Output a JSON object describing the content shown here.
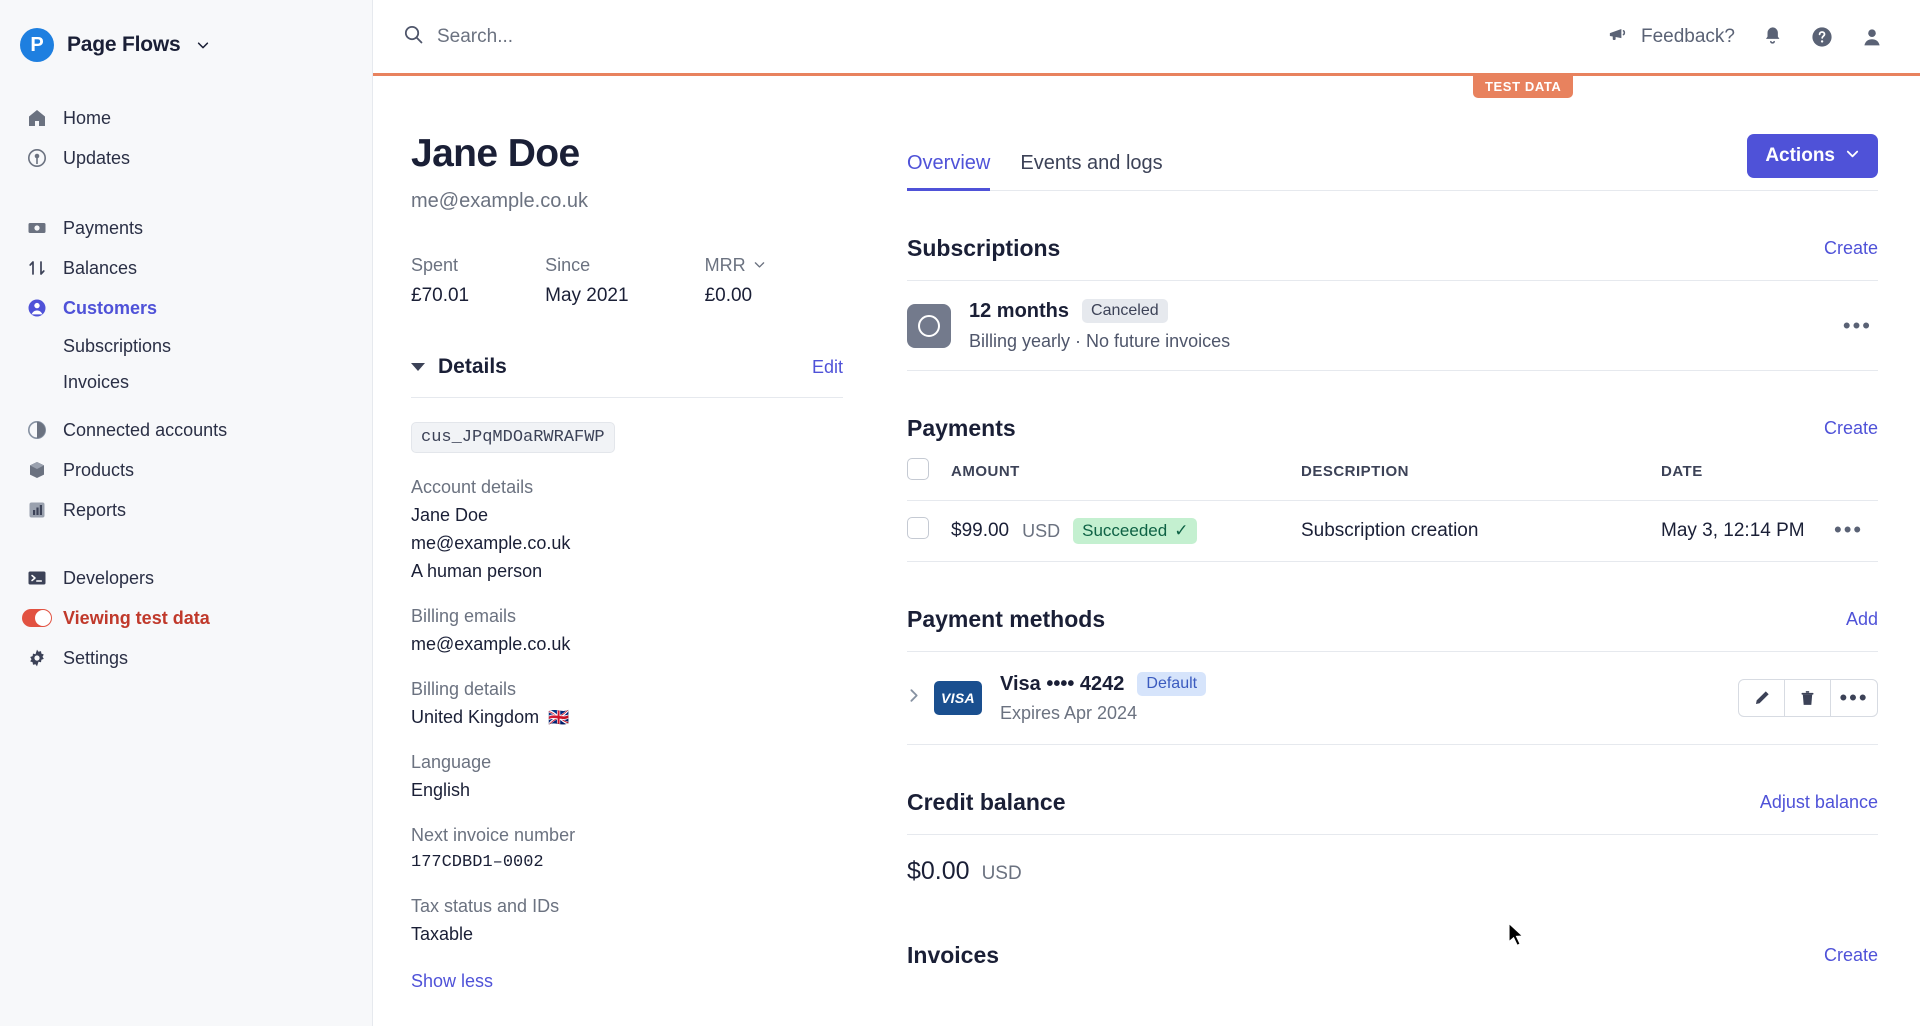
{
  "sidebar": {
    "brand": {
      "logo_letter": "P",
      "name": "Page Flows",
      "caret": "⌄"
    },
    "groups": [
      {
        "items": [
          {
            "label": "Home",
            "icon": "home-icon"
          },
          {
            "label": "Updates",
            "icon": "broadcast-icon"
          }
        ]
      },
      {
        "items": [
          {
            "label": "Payments",
            "icon": "payments-icon"
          },
          {
            "label": "Balances",
            "icon": "balances-icon"
          },
          {
            "label": "Customers",
            "icon": "customers-icon",
            "active": true
          },
          {
            "label": "Subscriptions",
            "sub": true
          },
          {
            "label": "Invoices",
            "sub": true
          },
          {
            "label": "Connected accounts",
            "icon": "connected-accounts-icon"
          },
          {
            "label": "Products",
            "icon": "products-icon"
          },
          {
            "label": "Reports",
            "icon": "reports-icon"
          }
        ]
      },
      {
        "items": [
          {
            "label": "Developers",
            "icon": "terminal-icon"
          },
          {
            "label": "Viewing test data",
            "icon": "toggle-on-icon",
            "testdata": true
          },
          {
            "label": "Settings",
            "icon": "gear-icon"
          }
        ]
      }
    ]
  },
  "topbar": {
    "search_placeholder": "Search...",
    "feedback_label": "Feedback?",
    "notifications_icon": "bell-icon",
    "help_icon": "help-icon",
    "account_icon": "user-avatar-icon",
    "accent_color": "#e8825e"
  },
  "test_data_badge": "TEST DATA",
  "customer": {
    "name": "Jane Doe",
    "email": "me@example.co.uk",
    "stats": [
      {
        "label": "Spent",
        "value": "£70.01",
        "dotted": true
      },
      {
        "label": "Since",
        "value": "May 2021",
        "dotted": false
      },
      {
        "label": "MRR",
        "value": "£0.00",
        "dotted": true,
        "caret": true
      }
    ]
  },
  "details": {
    "title": "Details",
    "edit_label": "Edit",
    "customer_id": "cus_JPqMDOaRWRAFWP",
    "fields": [
      {
        "label": "Account details",
        "values": [
          "Jane Doe",
          "me@example.co.uk",
          "A human person"
        ]
      },
      {
        "label": "Billing emails",
        "values": [
          "me@example.co.uk"
        ]
      },
      {
        "label": "Billing details",
        "values": [
          "United Kingdom"
        ],
        "flag": "🇬🇧"
      },
      {
        "label": "Language",
        "values": [
          "English"
        ]
      },
      {
        "label": "Next invoice number",
        "values": [
          "177CDBD1–0002"
        ],
        "mono": true
      },
      {
        "label": "Tax status and IDs",
        "values": [
          "Taxable"
        ]
      }
    ],
    "show_less_label": "Show less"
  },
  "tabs": [
    {
      "label": "Overview",
      "active": true
    },
    {
      "label": "Events and logs",
      "active": false
    }
  ],
  "actions_button": {
    "label": "Actions",
    "caret": "⌄",
    "color": "#4f52d8"
  },
  "subscriptions": {
    "title": "Subscriptions",
    "action_label": "Create",
    "rows": [
      {
        "title": "12 months",
        "status": "Canceled",
        "detail": "Billing yearly · No future invoices",
        "menu": "•••"
      }
    ]
  },
  "payments": {
    "title": "Payments",
    "action_label": "Create",
    "columns": [
      "AMOUNT",
      "DESCRIPTION",
      "DATE"
    ],
    "rows": [
      {
        "amount": "$99.00",
        "currency": "USD",
        "status": "Succeeded",
        "status_check": "✓",
        "description": "Subscription creation",
        "date": "May 3, 12:14 PM",
        "menu": "•••"
      }
    ]
  },
  "payment_methods": {
    "title": "Payment methods",
    "action_label": "Add",
    "rows": [
      {
        "brand": "VISA",
        "label": "Visa •••• 4242",
        "badge": "Default",
        "expires": "Expires Apr 2024",
        "buttons": [
          "edit-icon",
          "delete-icon",
          "more-icon"
        ]
      }
    ]
  },
  "credit_balance": {
    "title": "Credit balance",
    "action_label": "Adjust balance",
    "amount": "$0.00",
    "currency": "USD"
  },
  "invoices": {
    "title": "Invoices",
    "action_label": "Create"
  }
}
